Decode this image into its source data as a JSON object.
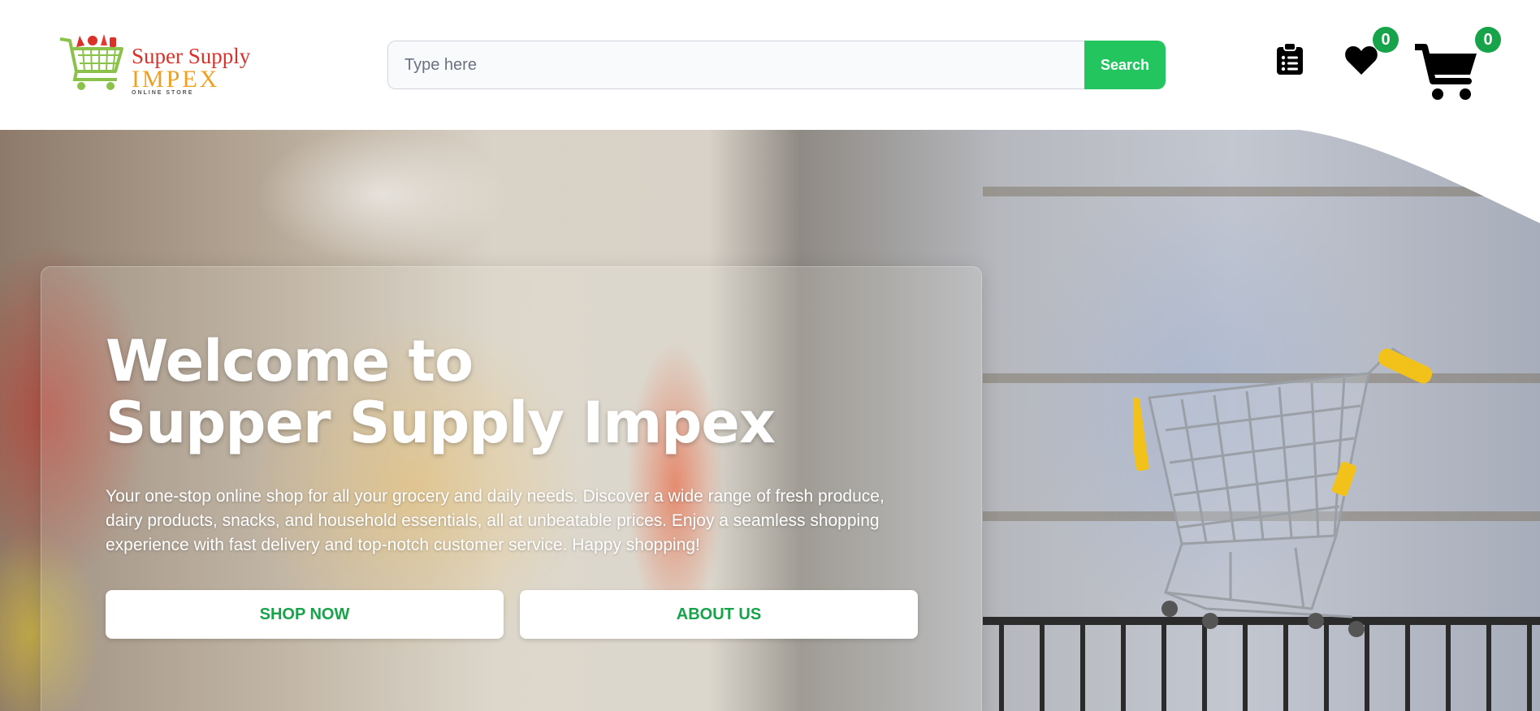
{
  "brand": {
    "name_line1": "Super Supply",
    "name_line2": "IMPEX",
    "tagline": "ONLINE STORE"
  },
  "search": {
    "placeholder": "Type here",
    "button_label": "Search"
  },
  "header_icons": {
    "orders": "clipboard-list-icon",
    "wishlist": "heart-icon",
    "cart": "shopping-cart-icon",
    "wishlist_count": "0",
    "cart_count": "0"
  },
  "hero": {
    "title_line1": "Welcome to",
    "title_line2": "Supper Supply Impex",
    "description": "Your one-stop online shop for all your grocery and daily needs. Discover a wide range of fresh produce, dairy products, snacks, and household essentials, all at unbeatable prices. Enjoy a seamless shopping experience with fast delivery and top-notch customer service. Happy shopping!",
    "primary_button": "SHOP NOW",
    "secondary_button": "ABOUT US"
  },
  "colors": {
    "accent_green": "#22c55e",
    "button_text_green": "#16a34a",
    "badge_green": "#16a34a"
  }
}
